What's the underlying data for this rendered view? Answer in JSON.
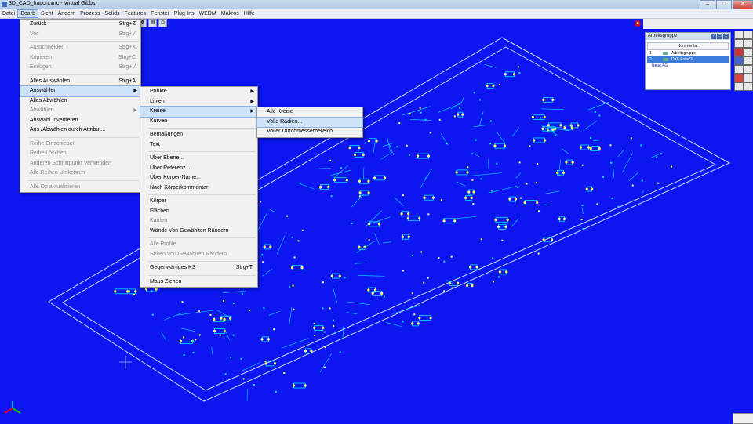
{
  "window": {
    "title": "3D_CAD_Import.vnc - Virtual Gibbs",
    "min": "–",
    "max": "□",
    "close": "✕"
  },
  "menubar": [
    "Datei",
    "Bearb",
    "Sicht",
    "Ändern",
    "Prozess",
    "Solids",
    "Features",
    "Fenster",
    "Plug-Ins",
    "WEDM",
    "Makros",
    "Hilfe"
  ],
  "edit_menu": [
    {
      "label": "Zurück",
      "shortcut": "Strg+Z"
    },
    {
      "label": "Vor",
      "shortcut": "Strg+Y",
      "disabled": true
    },
    {
      "sep": true
    },
    {
      "label": "Ausschneiden",
      "shortcut": "Strg+X",
      "disabled": true
    },
    {
      "label": "Kopieren",
      "shortcut": "Strg+C",
      "disabled": true
    },
    {
      "label": "Einfügen",
      "shortcut": "Strg+V",
      "disabled": true
    },
    {
      "sep": true
    },
    {
      "label": "Alles Auswählen",
      "shortcut": "Strg+A"
    },
    {
      "label": "Auswählen",
      "submenu": true,
      "highlight": true
    },
    {
      "label": "Alles Abwählen"
    },
    {
      "label": "Abwählen",
      "submenu": true,
      "disabled": true
    },
    {
      "label": "Auswahl Invertieren"
    },
    {
      "label": "Aus-/Abwählen durch Attribut..."
    },
    {
      "sep": true
    },
    {
      "label": "Reihe Einschieben",
      "disabled": true
    },
    {
      "label": "Reihe Löschen",
      "disabled": true
    },
    {
      "label": "Anderen Schnittpunkt Verwenden",
      "disabled": true
    },
    {
      "label": "Alle Reihen Umkehren",
      "disabled": true
    },
    {
      "sep": true
    },
    {
      "label": "Alle Op aktualisieren",
      "disabled": true
    }
  ],
  "select_menu": [
    {
      "label": "Punkte",
      "submenu": true
    },
    {
      "label": "Linien",
      "submenu": true
    },
    {
      "label": "Kreise",
      "submenu": true,
      "highlight": true
    },
    {
      "label": "Kurven"
    },
    {
      "sep": true
    },
    {
      "label": "Bemaßungen"
    },
    {
      "label": "Text"
    },
    {
      "sep": true
    },
    {
      "label": "Über Ebene..."
    },
    {
      "label": "Über Referenz..."
    },
    {
      "label": "Über Körper-Name..."
    },
    {
      "label": "Nach Körperkommentar"
    },
    {
      "sep": true
    },
    {
      "label": "Körper"
    },
    {
      "label": "Flächen"
    },
    {
      "label": "Kanten",
      "disabled": true
    },
    {
      "label": "Wände Von Gewählten Rändern"
    },
    {
      "sep": true
    },
    {
      "label": "Alle Profile",
      "disabled": true
    },
    {
      "label": "Seiten Von Gewählten Rändern",
      "disabled": true
    },
    {
      "sep": true
    },
    {
      "label": "Gegenwärtiges KS",
      "shortcut": "Strg+T"
    },
    {
      "sep": true
    },
    {
      "label": "Maus Ziehen"
    }
  ],
  "circles_menu": [
    {
      "label": "Alle Kreise"
    },
    {
      "label": "Volle Radien...",
      "highlight": true
    },
    {
      "label": "Voller Durchmesserbereich"
    }
  ],
  "panel": {
    "title": "Arbeitsgruppe",
    "column": "Kommentar",
    "rows": [
      {
        "num": "1",
        "name": "Arbeitsgruppe",
        "selected": false
      },
      {
        "num": "2",
        "name": "DXF Folie*2",
        "selected": true
      }
    ],
    "note": "Neue AG"
  },
  "colors": {
    "background": "#0b16f0",
    "part_outline": "#c9d7ff",
    "geometry": "#00e5ff",
    "highlight": "#ffff66"
  }
}
